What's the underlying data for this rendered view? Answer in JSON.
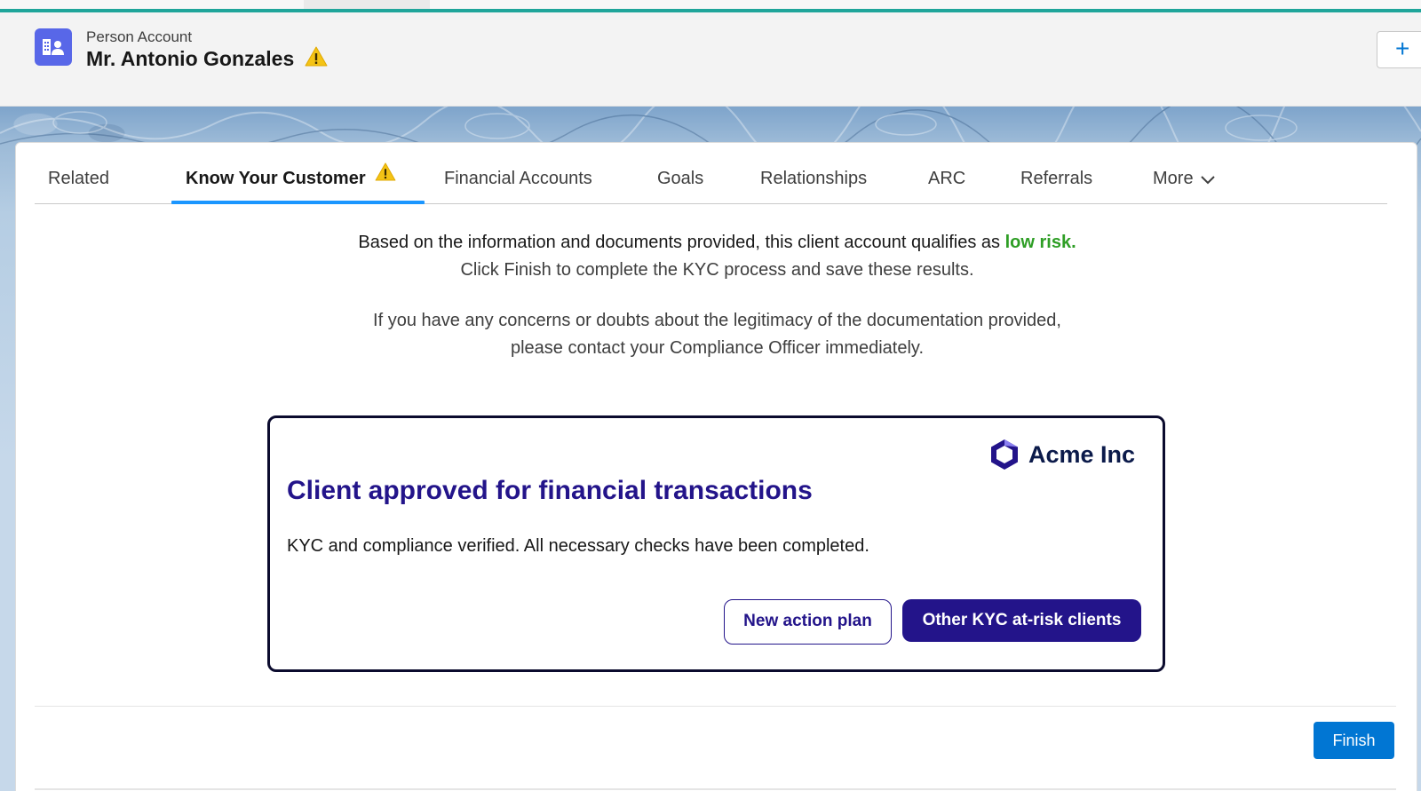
{
  "record": {
    "type_label": "Person Account",
    "name": "Mr. Antonio Gonzales",
    "plus_label": "+"
  },
  "tabs": [
    {
      "label": "Related"
    },
    {
      "label": "Know Your Customer"
    },
    {
      "label": "Financial Accounts"
    },
    {
      "label": "Goals"
    },
    {
      "label": "Relationships"
    },
    {
      "label": "ARC"
    },
    {
      "label": "Referrals"
    },
    {
      "label": "More"
    }
  ],
  "kyc": {
    "line1_prefix": "Based on the information and documents provided, this client account qualifies as",
    "line1_risk": "low risk.",
    "line2": "Click Finish to complete the KYC process and save these results.",
    "line3": "If you have any concerns or doubts about the legitimacy of the documentation provided,",
    "line4": "please contact your Compliance Officer immediately."
  },
  "result": {
    "brand": "Acme Inc",
    "title": "Client approved for financial transactions",
    "description": "KYC and compliance verified. All necessary checks have been completed.",
    "btn_new_action_plan": "New action plan",
    "btn_other_clients": "Other KYC at-risk clients"
  },
  "footer": {
    "finish_label": "Finish"
  },
  "colors": {
    "accent_teal": "#1fa59a",
    "brand_blue": "#0176d3",
    "tab_active_underline": "#1b96ff",
    "low_risk_green": "#2e9e25",
    "acme_purple": "#23148a",
    "record_icon": "#5867e8",
    "warning_yellow": "#f4c315"
  },
  "icons": {
    "record": "person-account-icon",
    "warning": "warning-icon",
    "more": "chevron-down-icon",
    "brand": "acme-logo-icon"
  }
}
